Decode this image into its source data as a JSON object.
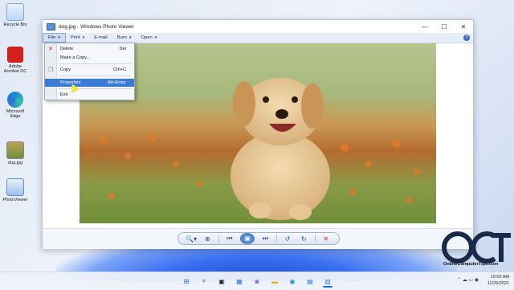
{
  "desktop": {
    "icons": [
      {
        "label": "Recycle Bin",
        "icon": "recycle-bin-icon"
      },
      {
        "label": "Adobe Acrobat DC",
        "icon": "acrobat-icon"
      },
      {
        "label": "Microsoft Edge",
        "icon": "edge-icon"
      },
      {
        "label": "dog.jpg",
        "icon": "image-file-icon"
      },
      {
        "label": "PhotoViewer",
        "icon": "photo-viewer-icon"
      }
    ]
  },
  "window": {
    "title": "dog.jpg - Windows Photo Viewer",
    "minimize": "—",
    "maximize": "☐",
    "close": "✕"
  },
  "menubar": {
    "items": [
      {
        "label": "File",
        "has_caret": true
      },
      {
        "label": "Print",
        "has_caret": true
      },
      {
        "label": "E-mail",
        "has_caret": false
      },
      {
        "label": "Burn",
        "has_caret": true
      },
      {
        "label": "Open",
        "has_caret": true
      }
    ],
    "help": "?"
  },
  "file_menu": {
    "items": [
      {
        "label": "Delete",
        "shortcut": "Del",
        "icon": "delete-x-icon"
      },
      {
        "label": "Make a Copy...",
        "shortcut": "",
        "icon": ""
      },
      {
        "label": "Copy",
        "shortcut": "Ctrl+C",
        "icon": "copy-icon"
      },
      {
        "label": "Properties",
        "shortcut": "Alt+Enter",
        "icon": "",
        "highlighted": true
      },
      {
        "label": "Exit",
        "shortcut": "",
        "icon": ""
      }
    ]
  },
  "controls": {
    "zoom": "🔍▾",
    "fit": "⊕",
    "previous": "⏮",
    "slideshow": "▣",
    "next": "⏭",
    "rotate_ccw": "↺",
    "rotate_cw": "↻",
    "delete": "✕"
  },
  "taskbar": {
    "time": "10:02 AM",
    "date": "11/25/2021",
    "tray": "⌃ ☁ ▭ ◉"
  },
  "watermark": {
    "brand": "OnlineComputerTips.com",
    "letters": "OCT"
  },
  "colors": {
    "highlight": "#3a7bd5",
    "delete_red": "#c62828",
    "accent_blue": "#2e63b5"
  }
}
